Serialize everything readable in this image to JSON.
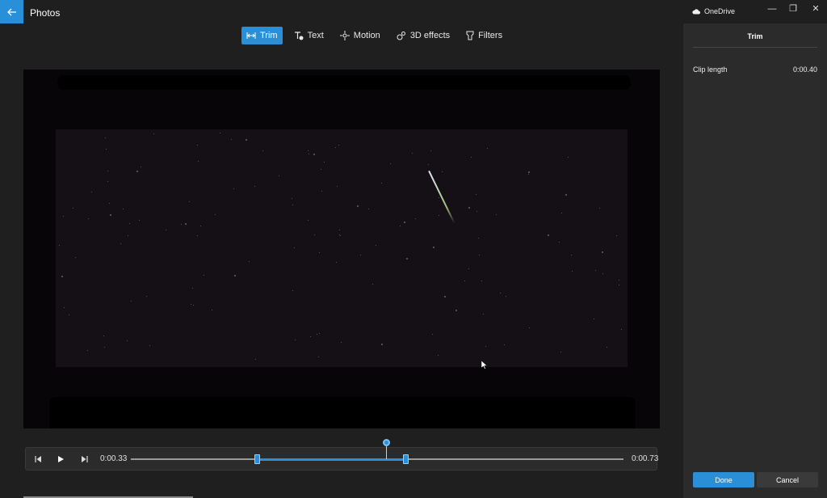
{
  "window": {
    "app_title": "Photos",
    "onedrive_label": "OneDrive",
    "minimize_glyph": "—",
    "maximize_glyph": "❐",
    "close_glyph": "✕"
  },
  "toolbar": {
    "items": [
      {
        "label": "Trim",
        "icon": "trim-icon",
        "active": true
      },
      {
        "label": "Text",
        "icon": "text-icon",
        "active": false
      },
      {
        "label": "Motion",
        "icon": "motion-icon",
        "active": false
      },
      {
        "label": "3D effects",
        "icon": "3d-effects-icon",
        "active": false
      },
      {
        "label": "Filters",
        "icon": "filters-icon",
        "active": false
      }
    ]
  },
  "playback": {
    "current_time": "0:00.33",
    "end_time": "0:00.73"
  },
  "panel": {
    "title": "Trim",
    "clip_length_label": "Clip length",
    "clip_length_value": "0:00.40",
    "done_label": "Done",
    "cancel_label": "Cancel"
  },
  "colors": {
    "accent": "#2a8fd6",
    "background": "#1f1f1f",
    "panel": "#2b2b2b"
  }
}
